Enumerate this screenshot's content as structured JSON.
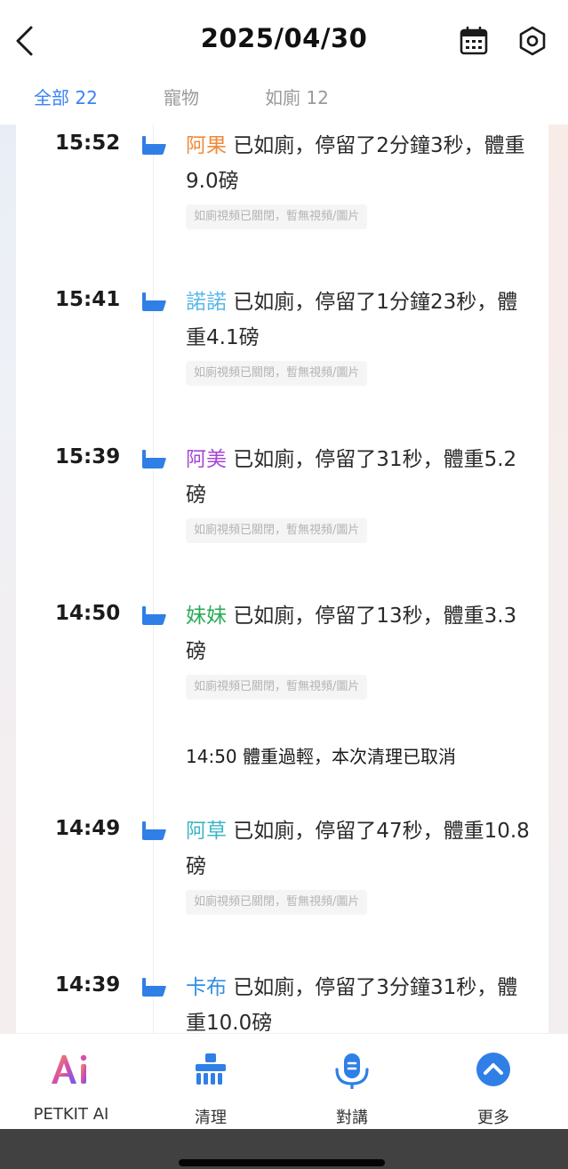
{
  "header": {
    "title": "2025/04/30"
  },
  "tabs": [
    {
      "label": "全部",
      "count": "22"
    },
    {
      "label": "寵物",
      "count": ""
    },
    {
      "label": "如廁",
      "count": "12"
    }
  ],
  "events": [
    {
      "time": "15:52",
      "pet": "阿果",
      "pet_color": "#f08a3a",
      "text": " 已如廁，停留了2分鐘3秒，體重9.0磅",
      "note": "如廁視頻已關閉，暫無視頻/圖片"
    },
    {
      "time": "15:41",
      "pet": "諾諾",
      "pet_color": "#5bb8e8",
      "text": " 已如廁，停留了1分鐘23秒，體重4.1磅",
      "note": "如廁視頻已關閉，暫無視頻/圖片"
    },
    {
      "time": "15:39",
      "pet": "阿美",
      "pet_color": "#a347d6",
      "text": " 已如廁，停留了31秒，體重5.2磅",
      "note": "如廁視頻已關閉，暫無視頻/圖片"
    },
    {
      "time": "14:50",
      "pet": "妹妹",
      "pet_color": "#2bab5a",
      "text": " 已如廁，停留了13秒，體重3.3磅",
      "note": "如廁視頻已關閉，暫無視頻/圖片"
    },
    {
      "time": "14:49",
      "pet": "阿草",
      "pet_color": "#3cb6c6",
      "text": " 已如廁，停留了47秒，體重10.8磅",
      "note": "如廁視頻已關閉，暫無視頻/圖片"
    },
    {
      "time": "14:39",
      "pet": "卡布",
      "pet_color": "#2f8ee6",
      "text": " 已如廁，停留了3分鐘31秒，體重10.0磅",
      "note": ""
    }
  ],
  "info": {
    "text": "14:50 體重過輕，本次清理已取消"
  },
  "bottom_nav": [
    {
      "label": "PETKIT AI",
      "icon": "ai-icon"
    },
    {
      "label": "清理",
      "icon": "broom-icon"
    },
    {
      "label": "對講",
      "icon": "microphone-icon"
    },
    {
      "label": "更多",
      "icon": "chevron-up-circle-icon"
    }
  ],
  "colors": {
    "accent": "#3b82f6",
    "icon_blue": "#2f7fe6"
  }
}
